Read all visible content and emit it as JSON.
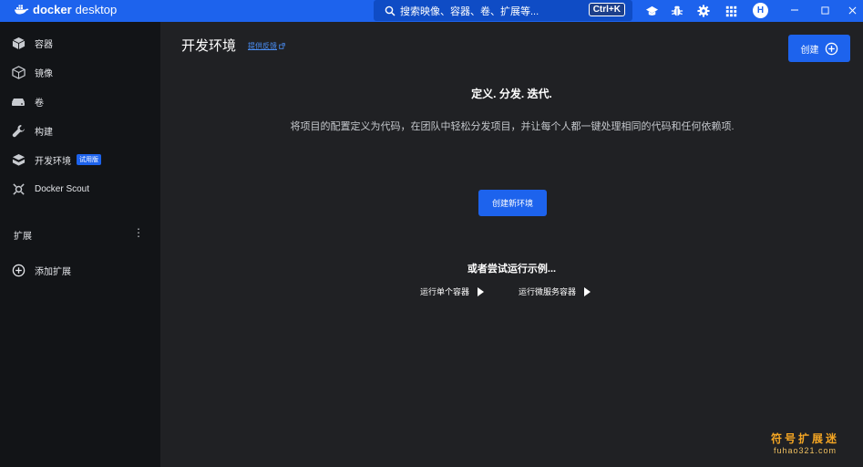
{
  "app": {
    "brand_bold": "docker",
    "brand_light": "desktop"
  },
  "search": {
    "placeholder": "搜索映像、容器、卷、扩展等...",
    "shortcut": "Ctrl+K"
  },
  "user": {
    "initial": "H"
  },
  "sidebar": {
    "items": [
      {
        "label": "容器",
        "icon": "container-icon"
      },
      {
        "label": "镜像",
        "icon": "image-icon"
      },
      {
        "label": "卷",
        "icon": "volume-icon"
      },
      {
        "label": "构建",
        "icon": "build-icon"
      },
      {
        "label": "开发环境",
        "icon": "dev-env-icon",
        "badge": "试用版"
      },
      {
        "label": "Docker Scout",
        "icon": "scout-icon"
      }
    ],
    "extensions_header": "扩展",
    "add_extension": "添加扩展"
  },
  "main": {
    "title": "开发环境",
    "feedback": "提供反馈",
    "create_label": "创建",
    "headline": "定义. 分发. 迭代.",
    "description": "将项目的配置定义为代码，在团队中轻松分发项目，并让每个人都一键处理相同的代码和任何依赖项.",
    "new_env_button": "创建新环境",
    "try_text": "或者尝试运行示例...",
    "samples": [
      "运行单个容器",
      "运行微服务容器"
    ]
  },
  "watermark": {
    "title": "符号扩展迷",
    "url": "fuhao321.com"
  },
  "colors": {
    "accent": "#1d63ed",
    "sidebar_bg": "#121417",
    "main_bg": "#202124"
  }
}
